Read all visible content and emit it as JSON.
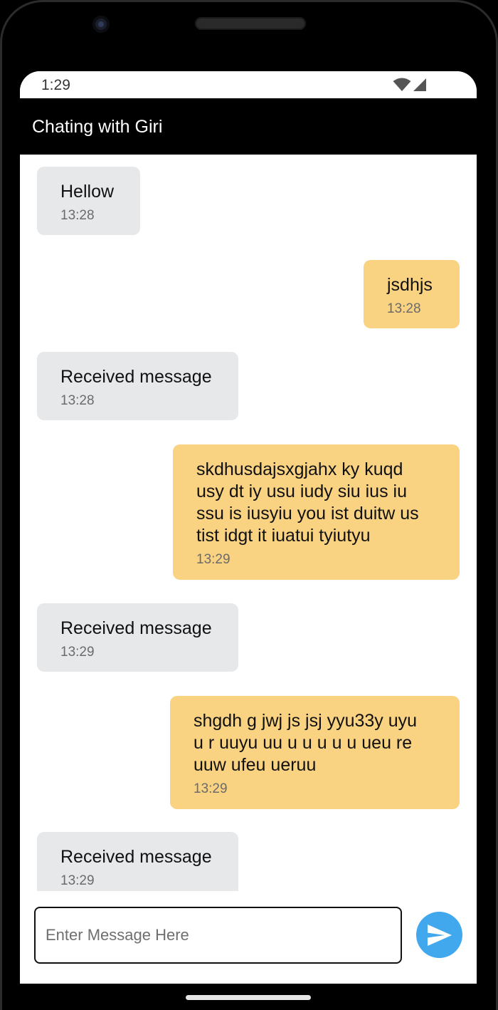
{
  "status_bar": {
    "time": "1:29",
    "icons": [
      "wifi-icon",
      "cell-signal-icon"
    ]
  },
  "app_bar": {
    "title": "Chating with Giri"
  },
  "messages": [
    {
      "type": "received",
      "text": "Hellow",
      "time": "13:28"
    },
    {
      "type": "sent",
      "text": "jsdhjs",
      "time": "13:28"
    },
    {
      "type": "received",
      "text": "Received message",
      "time": "13:28"
    },
    {
      "type": "sent",
      "text": "skdhusdajsxgjahx ky kuqd\nusy  dt iy usu iudy siu ius iu\nssu is iusyiu you ist duitw us\ntist idgt it iuatui tyiutyu",
      "time": "13:29"
    },
    {
      "type": "received",
      "text": "Received message",
      "time": "13:29"
    },
    {
      "type": "sent",
      "text": "shgdh g  jwj js jsj yyu33y uyu\nu r uuyu uu u u u u u ueu re\nuuw ufeu ueruu",
      "time": "13:29"
    },
    {
      "type": "received",
      "text": "Received message",
      "time": "13:29"
    }
  ],
  "composer": {
    "placeholder": "Enter Message Here",
    "value": "",
    "send_icon": "send-icon"
  },
  "colors": {
    "app_bar": "#000000",
    "received_bubble": "#e7e8ea",
    "sent_bubble": "#f9d282",
    "send_button": "#42a8ee"
  }
}
